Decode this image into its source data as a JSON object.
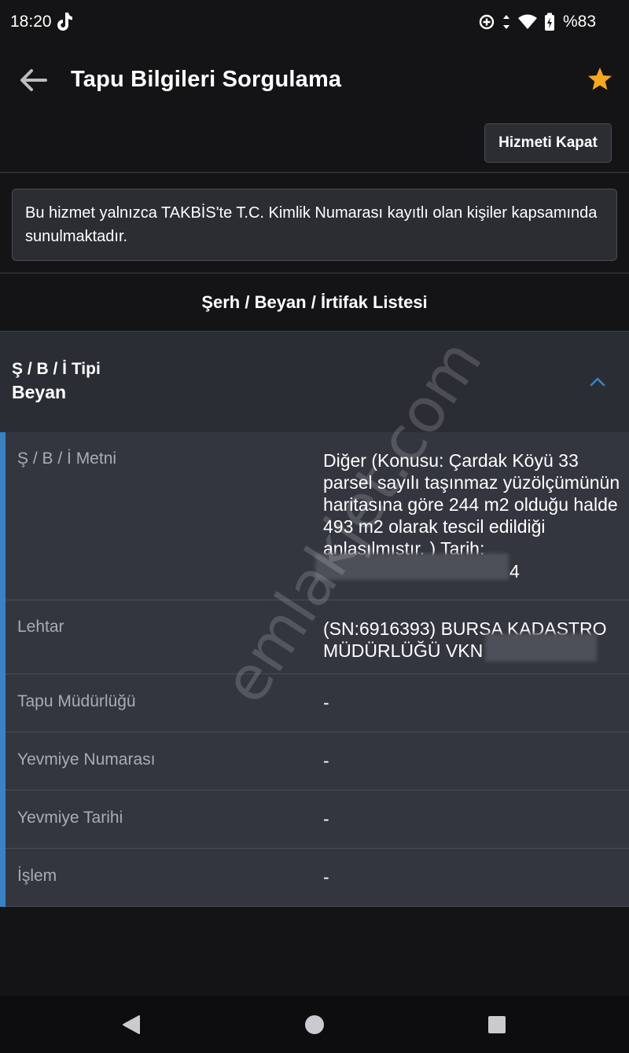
{
  "status_bar": {
    "time": "18:20",
    "battery_text": "%83",
    "icons": [
      "tiktok-icon",
      "data-saver-icon",
      "data-arrows-icon",
      "wifi-icon",
      "battery-charging-icon"
    ]
  },
  "app_bar": {
    "title": "Tapu Bilgileri Sorgulama",
    "back_icon": "arrow-left-icon",
    "favorite_icon": "star-icon"
  },
  "close_service_label": "Hizmeti Kapat",
  "info_message": "Bu hizmet yalnızca TAKBİS'te T.C. Kimlik Numarası kayıtlı olan kişiler kapsamında sunulmaktadır.",
  "section_title": "Şerh / Beyan / İrtifak Listesi",
  "accordion": {
    "label": "Ş / B / İ Tipi",
    "value": "Beyan",
    "toggle_icon": "chevron-up-icon"
  },
  "details": [
    {
      "label": "Ş / B / İ Metni",
      "value": "Diğer (Konusu: Çardak Köyü 33 parsel sayılı taşınmaz yüzölçümünün haritasına göre 244 m2 olduğu halde 493 m2 olarak tescil edildiği anlaşılmıştır. ) Tarih:",
      "value_tail": "4"
    },
    {
      "label": "Lehtar",
      "value": "(SN:6916393) BURSA KADASTRO MÜDÜRLÜĞÜ VKN"
    },
    {
      "label": "Tapu Müdürlüğü",
      "value": "-"
    },
    {
      "label": "Yevmiye Numarası",
      "value": "-"
    },
    {
      "label": "Yevmiye Tarihi",
      "value": "-"
    },
    {
      "label": "İşlem",
      "value": "-"
    }
  ],
  "watermark": "emlakjet.com",
  "colors": {
    "background": "#141416",
    "card": "#2a2d34",
    "detail": "#33363e",
    "accent_blue": "#3b82c4",
    "star": "#f5a623"
  },
  "nav_bar": {
    "icons": [
      "back-triangle-icon",
      "home-circle-icon",
      "recents-square-icon"
    ]
  }
}
